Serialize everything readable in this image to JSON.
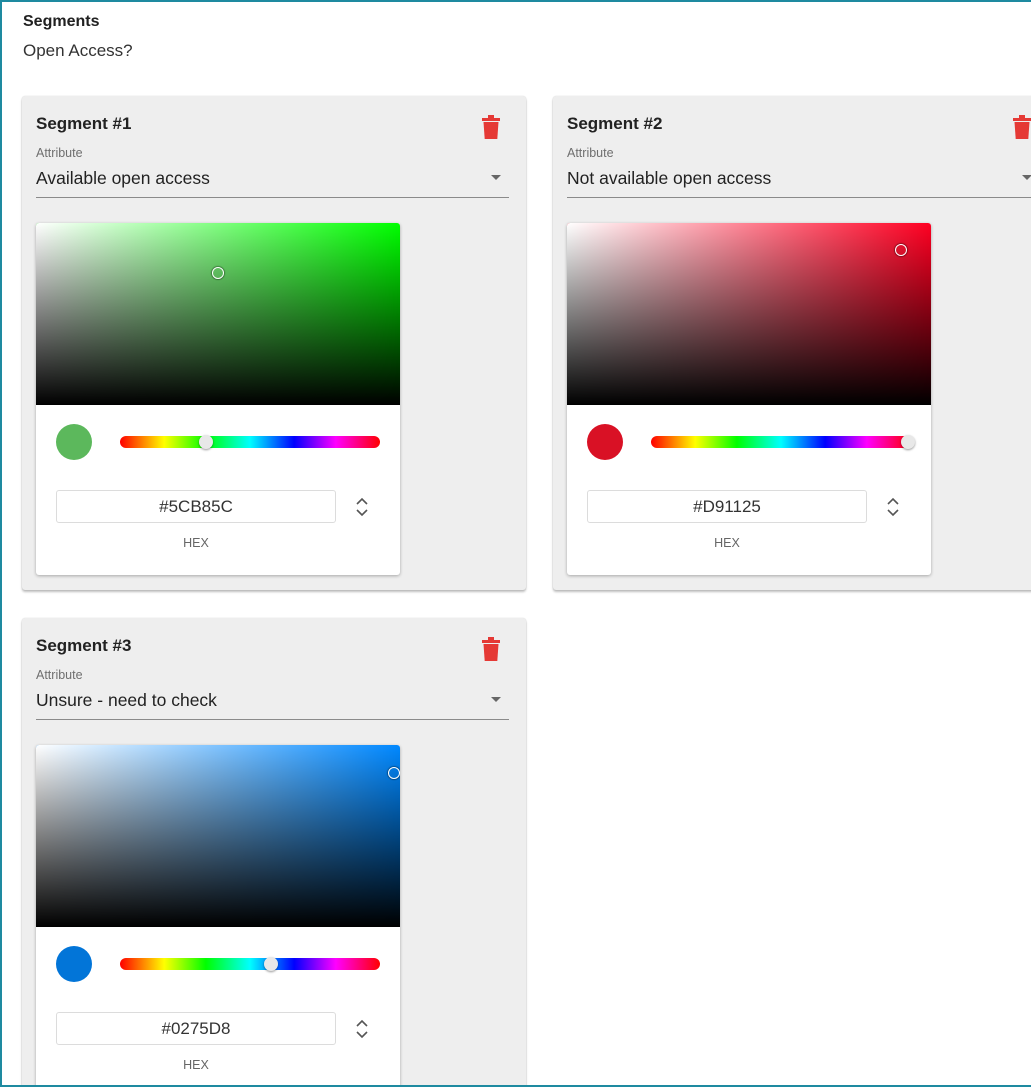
{
  "header": {
    "title": "Segments",
    "question": "Open Access?"
  },
  "segments": [
    {
      "title": "Segment #1",
      "attribute_label": "Attribute",
      "attribute_value": "Available open access",
      "hue_color": "#00ff00",
      "color": "#5CB85C",
      "hue_fraction": 0.33,
      "hex_value": "#5CB85C",
      "format_label": "HEX"
    },
    {
      "title": "Segment #2",
      "attribute_label": "Attribute",
      "attribute_value": "Not available open access",
      "hue_color": "#ff0022",
      "color": "#D91125",
      "hue_fraction": 0.99,
      "hex_value": "#D91125",
      "format_label": "HEX"
    },
    {
      "title": "Segment #3",
      "attribute_label": "Attribute",
      "attribute_value": "Unsure - need to check",
      "hue_color": "#0088ff",
      "color": "#0275D8",
      "hue_fraction": 0.58,
      "hex_value": "#0275D8",
      "format_label": "HEX"
    }
  ],
  "colors": {
    "trash": "#e53935",
    "frame_border": "#1e8aa0"
  }
}
